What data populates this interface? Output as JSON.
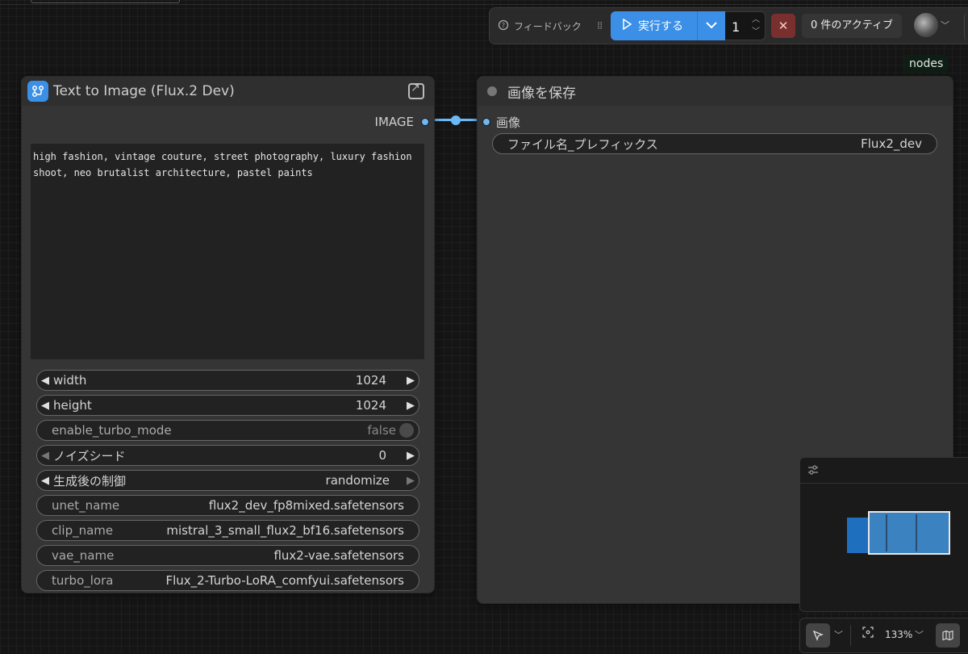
{
  "toolbar": {
    "feedback_label": "フィードバック",
    "run_label": "実行する",
    "batch_count": "1",
    "active_label": "0 件のアクティブ"
  },
  "nodes_tag": "nodes",
  "node_text_to_image": {
    "title": "Text to Image (Flux.2 Dev)",
    "output_label": "IMAGE",
    "prompt": "high fashion, vintage couture, street photography, luxury fashion shoot, neo brutalist architecture, pastel paints",
    "widgets": [
      {
        "label": "width",
        "value": "1024"
      },
      {
        "label": "height",
        "value": "1024"
      },
      {
        "label": "enable_turbo_mode",
        "value": "false"
      },
      {
        "label": "ノイズシード",
        "value": "0"
      },
      {
        "label": "生成後の制御",
        "value": "randomize"
      },
      {
        "label": "unet_name",
        "value": "flux2_dev_fp8mixed.safetensors"
      },
      {
        "label": "clip_name",
        "value": "mistral_3_small_flux2_bf16.safetensors"
      },
      {
        "label": "vae_name",
        "value": "flux2-vae.safetensors"
      },
      {
        "label": "turbo_lora",
        "value": "Flux_2-Turbo-LoRA_comfyui.safetensors"
      }
    ]
  },
  "node_save_image": {
    "title": "画像を保存",
    "input_label": "画像",
    "widget": {
      "label": "ファイル名_プレフィックス",
      "value": "Flux2_dev"
    }
  },
  "bottom": {
    "zoom": "133%"
  },
  "colors": {
    "accent": "#3b8fe6",
    "link": "#6cb8f5",
    "cancel": "#7a2f2f"
  }
}
